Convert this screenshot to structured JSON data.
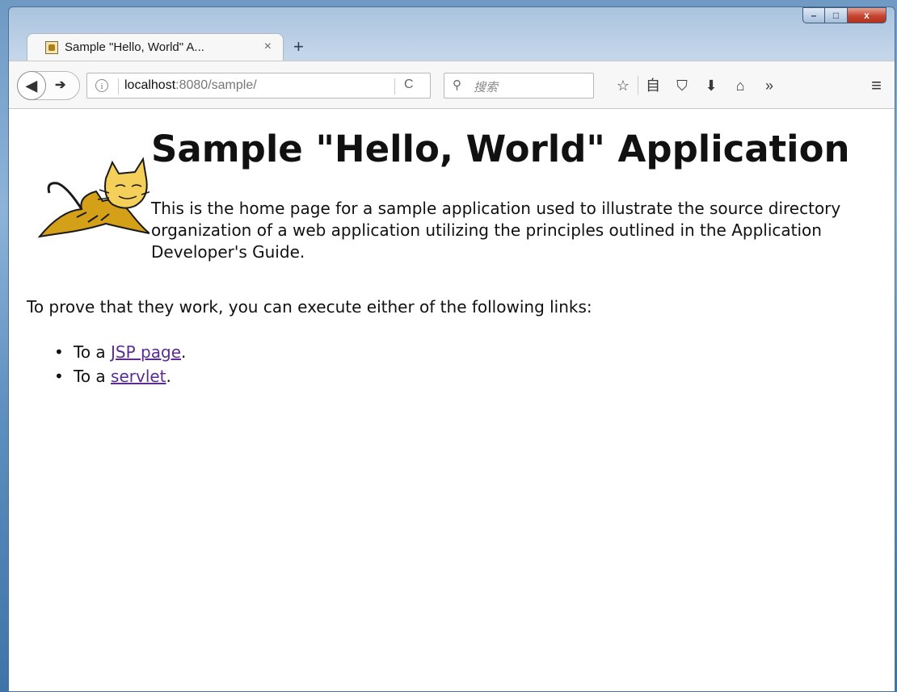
{
  "browser": {
    "tab": {
      "title": "Sample \"Hello, World\" A...",
      "close_glyph": "×"
    },
    "new_tab_glyph": "+",
    "window_buttons": {
      "minimize": "–",
      "maximize": "□",
      "close": "x"
    },
    "url": {
      "host": "localhost",
      "rest": ":8080/sample/"
    },
    "search": {
      "placeholder": "搜索"
    },
    "toolbar": [
      "star-icon",
      "reading-list-icon",
      "pocket-icon",
      "download-icon",
      "home-icon",
      "overflow-icon"
    ],
    "glyphs": {
      "back": "◀",
      "forward": "➔",
      "info": "i",
      "reload": "C",
      "search": "⚲",
      "star": "☆",
      "reading": "自",
      "pocket": "⛉",
      "download": "⬇",
      "home": "⌂",
      "overflow": "»",
      "menu": "≡"
    }
  },
  "page": {
    "title": "Sample \"Hello, World\" Application",
    "intro": "This is the home page for a sample application used to illustrate the source directory organization of a web application utilizing the principles outlined in the Application Developer's Guide.",
    "prove": "To prove that they work, you can execute either of the following links:",
    "links": [
      {
        "prefix": "To a ",
        "label": "JSP page",
        "suffix": "."
      },
      {
        "prefix": "To a ",
        "label": "servlet",
        "suffix": "."
      }
    ]
  },
  "colors": {
    "link_visited": "#5a2d91",
    "logo_fill": "#d4a017"
  }
}
